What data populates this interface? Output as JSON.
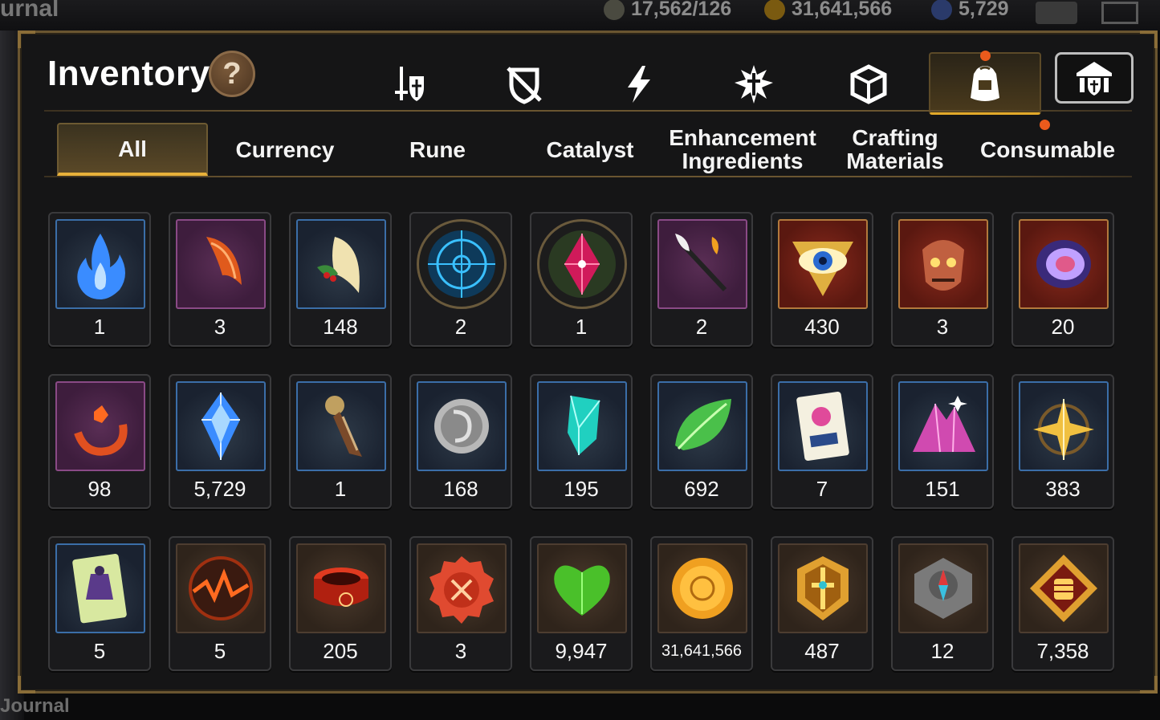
{
  "hud": {
    "title": "urnal",
    "stat1": "17,562/126",
    "stat2": "31,641,566",
    "stat3": "5,729",
    "footer": "Journal"
  },
  "panel": {
    "title": "Inventory",
    "help_label": "?"
  },
  "category_icons": [
    {
      "name": "sword-shield-icon"
    },
    {
      "name": "broken-shield-icon"
    },
    {
      "name": "lightning-icon"
    },
    {
      "name": "burst-sword-icon"
    },
    {
      "name": "cube-icon"
    },
    {
      "name": "backpack-icon",
      "active": true,
      "notify": true
    },
    {
      "name": "guild-hall-icon"
    }
  ],
  "sub_tabs": [
    {
      "label": "All",
      "active": true
    },
    {
      "label": "Currency"
    },
    {
      "label": "Rune"
    },
    {
      "label": "Catalyst"
    },
    {
      "label": "Enhancement Ingredients"
    },
    {
      "label": "Crafting Materials"
    },
    {
      "label": "Consumable",
      "notify": true
    }
  ],
  "items": [
    {
      "icon": "blue-flame-icon",
      "count": "1",
      "frame": "blue"
    },
    {
      "icon": "phoenix-feather-icon",
      "count": "3",
      "frame": "purple"
    },
    {
      "icon": "golden-feather-icon",
      "count": "148",
      "frame": "blue"
    },
    {
      "icon": "blue-rune-disc-icon",
      "count": "2",
      "frame": "round"
    },
    {
      "icon": "crimson-crystal-icon",
      "count": "1",
      "frame": "round"
    },
    {
      "icon": "quill-wand-icon",
      "count": "2",
      "frame": "purple"
    },
    {
      "icon": "golden-eye-icon",
      "count": "430",
      "frame": "red"
    },
    {
      "icon": "demon-mask-icon",
      "count": "3",
      "frame": "red"
    },
    {
      "icon": "purple-medallion-icon",
      "count": "20",
      "frame": "red"
    },
    {
      "icon": "orange-amulet-icon",
      "count": "98",
      "frame": "purple"
    },
    {
      "icon": "blue-crystal-icon",
      "count": "5,729",
      "frame": "blue"
    },
    {
      "icon": "lantern-dagger-icon",
      "count": "1",
      "frame": "blue"
    },
    {
      "icon": "silver-coin-icon",
      "count": "168",
      "frame": "blue"
    },
    {
      "icon": "teal-crystal-icon",
      "count": "195",
      "frame": "blue"
    },
    {
      "icon": "green-leaf-icon",
      "count": "692",
      "frame": "blue"
    },
    {
      "icon": "pet-card-icon",
      "count": "7",
      "frame": "blue"
    },
    {
      "icon": "pink-ore-icon",
      "count": "151",
      "frame": "blue"
    },
    {
      "icon": "star-compass-icon",
      "count": "383",
      "frame": "blue"
    },
    {
      "icon": "costume-card-icon",
      "count": "5",
      "frame": "blue"
    },
    {
      "icon": "fire-orb-icon",
      "count": "5",
      "frame": "brown"
    },
    {
      "icon": "red-bracelet-icon",
      "count": "205",
      "frame": "brown"
    },
    {
      "icon": "red-seal-icon",
      "count": "3",
      "frame": "brown"
    },
    {
      "icon": "green-heart-icon",
      "count": "9,947",
      "frame": "brown"
    },
    {
      "icon": "gold-coin-icon",
      "count": "31,641,566",
      "frame": "brown",
      "small": true
    },
    {
      "icon": "gold-crest-icon",
      "count": "487",
      "frame": "brown"
    },
    {
      "icon": "stone-compass-icon",
      "count": "12",
      "frame": "brown"
    },
    {
      "icon": "fist-emblem-icon",
      "count": "7,358",
      "frame": "brown"
    }
  ],
  "colors": {
    "accent_gold": "#e2a92a",
    "frame_border": "#6a5530",
    "notify": "#ea5a1c"
  }
}
